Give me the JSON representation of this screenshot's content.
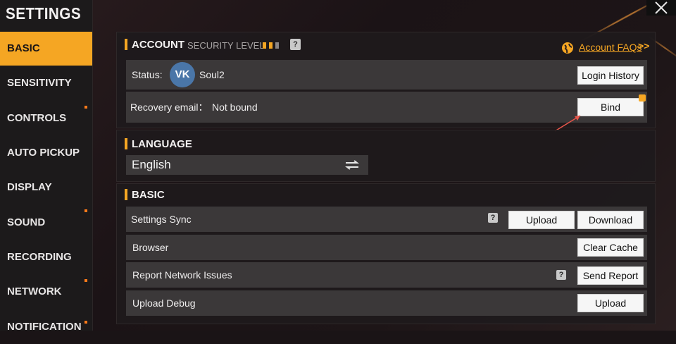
{
  "sidebar": {
    "title": "SETTINGS",
    "items": [
      {
        "label": "BASIC",
        "active": true,
        "dot": false
      },
      {
        "label": "SENSITIVITY",
        "active": false,
        "dot": false
      },
      {
        "label": "CONTROLS",
        "active": false,
        "dot": true
      },
      {
        "label": "AUTO PICKUP",
        "active": false,
        "dot": false
      },
      {
        "label": "DISPLAY",
        "active": false,
        "dot": false
      },
      {
        "label": "SOUND",
        "active": false,
        "dot": true
      },
      {
        "label": "RECORDING",
        "active": false,
        "dot": false
      },
      {
        "label": "NETWORK",
        "active": false,
        "dot": true
      },
      {
        "label": "NOTIFICATION",
        "active": false,
        "dot": true
      }
    ]
  },
  "account": {
    "title": "ACCOUNT",
    "security_label": "SECURITY LEVEL",
    "security_level_filled": 2,
    "security_level_total": 3,
    "faq_link": "Account FAQs",
    "faq_arrows": ">>",
    "status_label": "Status:",
    "vk_icon_text": "VK",
    "username": "Soul2",
    "login_history_label": "Login History",
    "recovery_label": "Recovery email：",
    "recovery_value": "Not bound",
    "bind_label": "Bind"
  },
  "language": {
    "title": "LANGUAGE",
    "current": "English"
  },
  "basic": {
    "title": "BASIC",
    "settings_sync_label": "Settings Sync",
    "upload_label": "Upload",
    "download_label": "Download",
    "browser_label": "Browser",
    "clear_cache_label": "Clear Cache",
    "report_label": "Report Network Issues",
    "send_report_label": "Send Report",
    "upload_debug_label": "Upload Debug",
    "upload_debug_button": "Upload"
  },
  "help_glyph": "?",
  "colors": {
    "accent": "#f5a623",
    "row": "#3b3839",
    "vk_blue": "#4a76a8"
  }
}
